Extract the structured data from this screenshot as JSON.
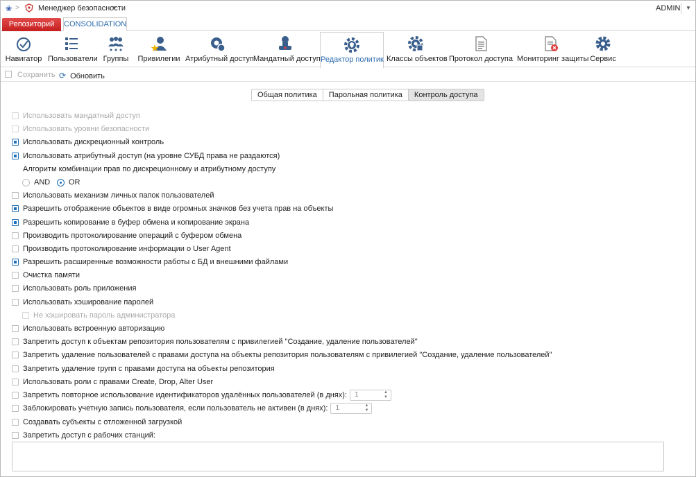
{
  "app": {
    "title": "Менеджер безопасности",
    "user": "ADMIN"
  },
  "top_tabs": [
    {
      "label": "Репозиторий"
    },
    {
      "label": "CONSOLIDATION"
    }
  ],
  "ribbon": [
    {
      "label": "Навигатор",
      "icon": "navigator-icon"
    },
    {
      "label": "Пользователи",
      "icon": "users-list-icon"
    },
    {
      "label": "Группы",
      "icon": "groups-icon"
    },
    {
      "label": "Привилегии",
      "icon": "privileges-icon"
    },
    {
      "label": "Атрибутный доступ",
      "icon": "attribute-access-icon"
    },
    {
      "label": "Мандатный доступ",
      "icon": "mandatory-access-icon"
    },
    {
      "label": "Редактор политик",
      "icon": "policy-editor-icon"
    },
    {
      "label": "Классы объектов",
      "icon": "object-classes-icon"
    },
    {
      "label": "Протокол доступа",
      "icon": "access-log-icon"
    },
    {
      "label": "Мониторинг защиты",
      "icon": "protection-monitoring-icon"
    },
    {
      "label": "Сервис",
      "icon": "service-icon"
    }
  ],
  "toolbar": {
    "save": "Сохранить",
    "refresh": "Обновить"
  },
  "policy_tabs": [
    {
      "label": "Общая политика"
    },
    {
      "label": "Парольная политика"
    },
    {
      "label": "Контроль доступа"
    }
  ],
  "settings": {
    "mandatory": "Использовать мандатный доступ",
    "levels": "Использовать уровни безопасности",
    "discretionary": "Использовать дискреционный контроль",
    "attribute": "Использовать атрибутный доступ (на уровне СУБД права не раздаются)",
    "combo_label": "Алгоритм комбинации прав по дискреционному и атрибутному доступу",
    "and": "AND",
    "or": "OR",
    "personal_folders": "Использовать механизм личных папок пользователей",
    "big_icons": "Разрешить отображение объектов в виде огромных значков без учета прав на объекты",
    "clipboard": "Разрешить копирование в буфер обмена и копирование экрана",
    "clipboard_log": "Производить протоколирование операций с буфером обмена",
    "user_agent_log": "Производить протоколирование информации о User Agent",
    "extended_db": "Разрешить расширенные возможности работы с БД и внешними файлами",
    "memory_clear": "Очистка памяти",
    "app_role": "Использовать роль приложения",
    "pwd_hash": "Использовать хэширование паролей",
    "no_admin_hash": "Не хэшировать пароль администратора",
    "builtin_auth": "Использовать встроенную авторизацию",
    "deny_repo_access": "Запретить доступ к объектам репозитория пользователям с привилегией \"Создание, удаление пользователей\"",
    "deny_user_delete": "Запретить удаление пользователей с правами доступа на объекты репозитория пользователям с привилегией \"Создание, удаление пользователей\"",
    "deny_group_delete": "Запретить удаление групп с правами доступа на объекты репозитория",
    "roles_cda": "Использовать роли с правами Create, Drop, Alter User",
    "deny_reuse_ids": "Запретить повторное использование идентификаторов удалённых пользователей (в днях):",
    "deny_reuse_value": "1",
    "block_inactive": "Заблокировать учетную запись пользователя, если пользователь не активен (в днях):",
    "block_inactive_value": "1",
    "deferred_subjects": "Создавать субъекты с отложенной загрузкой",
    "deny_workstations": "Запретить доступ с рабочих станций:"
  }
}
